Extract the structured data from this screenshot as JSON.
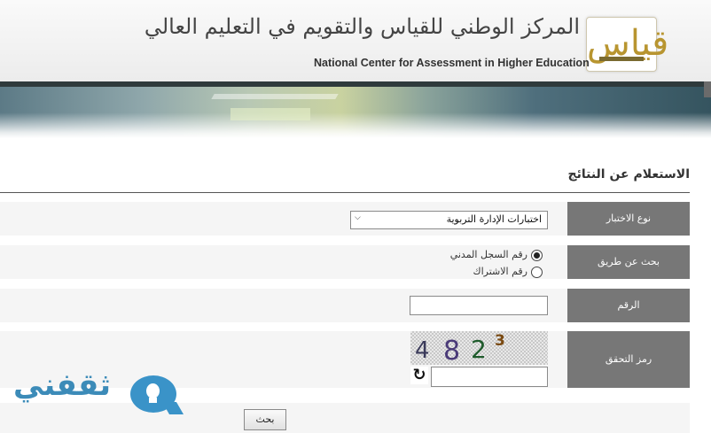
{
  "header": {
    "org_name_ar": "المركز الوطني للقياس والتقويم في التعليم العالي",
    "org_name_en": "National Center for Assessment in Higher Education",
    "logo_text": "قياس"
  },
  "page": {
    "title": "الاستعلام عن النتائج"
  },
  "form": {
    "test_type": {
      "label": "نوع الاختبار",
      "selected": "اختبارات الإدارة التربوية"
    },
    "search_by": {
      "label": "بحث عن طريق",
      "options": [
        {
          "label": "رقم السجل المدني",
          "checked": true
        },
        {
          "label": "رقم الاشتراك",
          "checked": false
        }
      ]
    },
    "number": {
      "label": "الرقم",
      "value": ""
    },
    "captcha": {
      "label": "رمز التحقق",
      "image_digits": [
        "4",
        "8",
        "2",
        "3"
      ],
      "value": ""
    },
    "submit_label": "بحث"
  },
  "watermark": {
    "text": "ثقفني"
  },
  "colors": {
    "label_bg": "#777777",
    "row_bg": "#f5f5f5",
    "watermark": "#3a93c8"
  },
  "icons": {
    "refresh": "refresh-icon",
    "dropdown": "chevron-down-icon",
    "watermark": "lightbulb-chat-icon"
  }
}
